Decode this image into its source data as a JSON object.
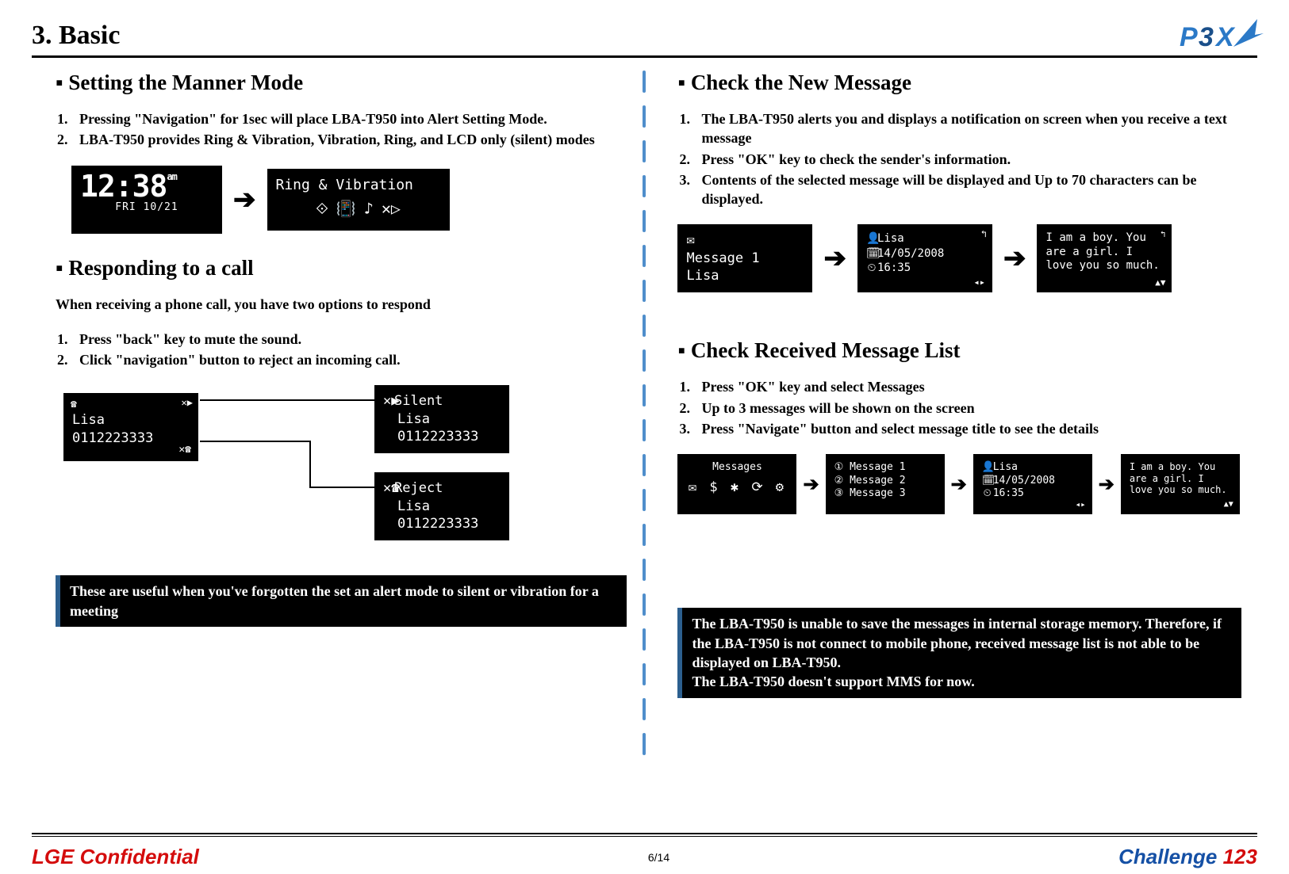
{
  "page_title": "3. Basic",
  "logo_text": "P3X",
  "left": {
    "sec1": {
      "title": "Setting the Manner Mode",
      "items": [
        "Pressing \"Navigation\" for 1sec will place LBA-T950 into Alert Setting Mode.",
        "LBA-T950 provides Ring & Vibration, Vibration, Ring, and LCD only (silent) modes"
      ],
      "screen_clock": {
        "time": "12:38",
        "ampm": "am",
        "date": "FRI 10/21"
      },
      "screen_ring": {
        "title": "Ring & Vibration"
      }
    },
    "sec2": {
      "title": "Responding to a call",
      "intro": "When receiving a phone call, you have two options to respond",
      "items": [
        "Press \"back\" key to mute the sound.",
        "Click \"navigation\" button to reject an incoming call."
      ],
      "screen_incoming": {
        "name": "Lisa",
        "number": "0112223333"
      },
      "screen_silent": {
        "label": "Silent",
        "name": "Lisa",
        "number": "0112223333"
      },
      "screen_reject": {
        "label": "Reject",
        "name": "Lisa",
        "number": "0112223333"
      }
    },
    "note": "These are useful when you've forgotten the set an alert mode to silent or vibration for a meeting"
  },
  "right": {
    "sec1": {
      "title": "Check the New Message",
      "items": [
        "The LBA-T950 alerts you and displays a notification on screen when you receive a text message",
        "Press \"OK\"  key to check the sender's information.",
        "Contents of the selected message will be displayed and Up to 70 characters can be displayed."
      ],
      "screen_notify": {
        "l1": "✉",
        "l2": "Message 1",
        "l3": "Lisa"
      },
      "screen_sender": {
        "name": "Lisa",
        "date": "14/05/2008",
        "time": "16:35"
      },
      "screen_body": "I am a boy. You are a girl. I love you so much."
    },
    "sec2": {
      "title": "Check Received Message List",
      "items": [
        "Press \"OK\" key and select Messages",
        "Up to 3 messages will be shown on the screen",
        "Press \"Navigate\" button and select message title to see the details"
      ],
      "screen_menu": {
        "title": "Messages"
      },
      "screen_list": {
        "m1": "Message 1",
        "m2": "Message 2",
        "m3": "Message 3"
      },
      "screen_sender": {
        "name": "Lisa",
        "date": "14/05/2008",
        "time": "16:35"
      },
      "screen_body": "I am a boy. You are a girl. I love you so much."
    },
    "note": "The LBA-T950 is unable to save the messages in internal storage memory. Therefore, if the LBA-T950 is not connect to mobile phone, received message list is not able to be displayed on LBA-T950.\nThe LBA-T950 doesn't support MMS for now."
  },
  "footer": {
    "confidential": "LGE Confidential",
    "page": "6/14",
    "challenge_label": "Challenge ",
    "challenge_num": "123"
  }
}
